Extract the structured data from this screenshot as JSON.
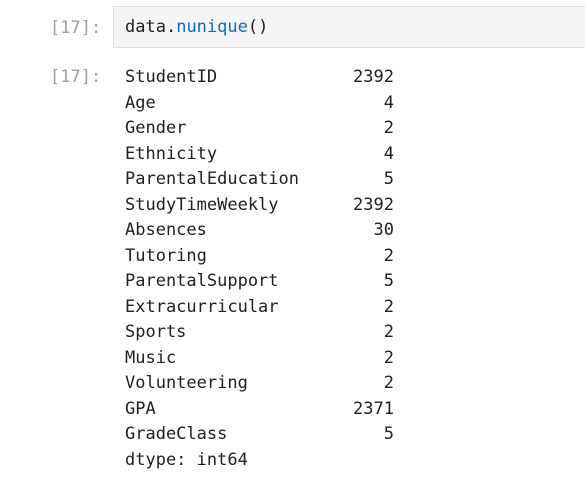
{
  "input_cell": {
    "prompt": "[17]:",
    "code": {
      "var": "data",
      "dot": ".",
      "func": "nunique",
      "parens": "()"
    }
  },
  "output_cell": {
    "prompt": "[17]:",
    "rows": [
      {
        "name": "StudentID",
        "value": "2392"
      },
      {
        "name": "Age",
        "value": "4"
      },
      {
        "name": "Gender",
        "value": "2"
      },
      {
        "name": "Ethnicity",
        "value": "4"
      },
      {
        "name": "ParentalEducation",
        "value": "5"
      },
      {
        "name": "StudyTimeWeekly",
        "value": "2392"
      },
      {
        "name": "Absences",
        "value": "30"
      },
      {
        "name": "Tutoring",
        "value": "2"
      },
      {
        "name": "ParentalSupport",
        "value": "5"
      },
      {
        "name": "Extracurricular",
        "value": "2"
      },
      {
        "name": "Sports",
        "value": "2"
      },
      {
        "name": "Music",
        "value": "2"
      },
      {
        "name": "Volunteering",
        "value": "2"
      },
      {
        "name": "GPA",
        "value": "2371"
      },
      {
        "name": "GradeClass",
        "value": "5"
      }
    ],
    "dtype": "dtype: int64"
  }
}
